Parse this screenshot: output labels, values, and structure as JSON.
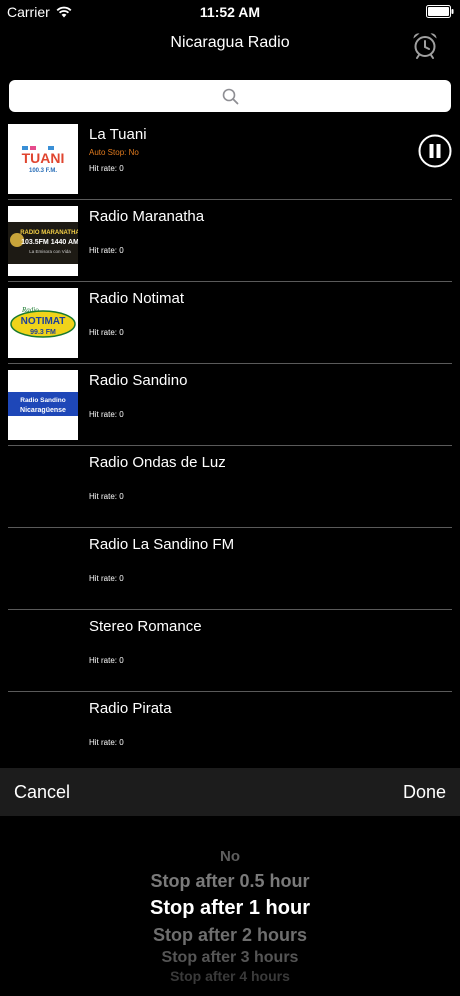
{
  "status_bar": {
    "carrier": "Carrier",
    "time": "11:52 AM"
  },
  "nav": {
    "title": "Nicaragua Radio"
  },
  "search": {
    "placeholder": ""
  },
  "stations": [
    {
      "name": "La Tuani",
      "auto_stop": "Auto Stop: No",
      "hit_rate": "Hit rate: 0",
      "logo_text": [
        "TUANI",
        "100.3 F.M."
      ]
    },
    {
      "name": "Radio Maranatha",
      "hit_rate": "Hit rate: 0",
      "logo_text": [
        "RADIO MARANATHA",
        "103.5FM 1440 AM",
        "La Emisora con Vida"
      ]
    },
    {
      "name": "Radio Notimat",
      "hit_rate": "Hit rate: 0",
      "logo_text": [
        "Radio",
        "NOTIMAT",
        "99.3 FM"
      ]
    },
    {
      "name": "Radio Sandino",
      "hit_rate": "Hit rate: 0",
      "logo_text": [
        "Radio Sandino",
        "Nicaragüense"
      ]
    },
    {
      "name": "Radio Ondas de Luz",
      "hit_rate": "Hit rate: 0"
    },
    {
      "name": "Radio La Sandino FM",
      "hit_rate": "Hit rate: 0"
    },
    {
      "name": "Stereo Romance",
      "hit_rate": "Hit rate: 0"
    },
    {
      "name": "Radio Pirata",
      "hit_rate": "Hit rate: 0"
    }
  ],
  "toolbar": {
    "cancel_label": "Cancel",
    "done_label": "Done"
  },
  "picker": {
    "options": [
      "No",
      "Stop after 0.5 hour",
      "Stop after 1 hour",
      "Stop after 2 hours",
      "Stop after 3 hours",
      "Stop after 4 hours"
    ],
    "selected": "Stop after 1 hour"
  },
  "colors": {
    "background": "#000000",
    "accent_orange": "#e07a1e",
    "separator": "#5a5a5a",
    "toolbar": "#1c1c1c"
  }
}
